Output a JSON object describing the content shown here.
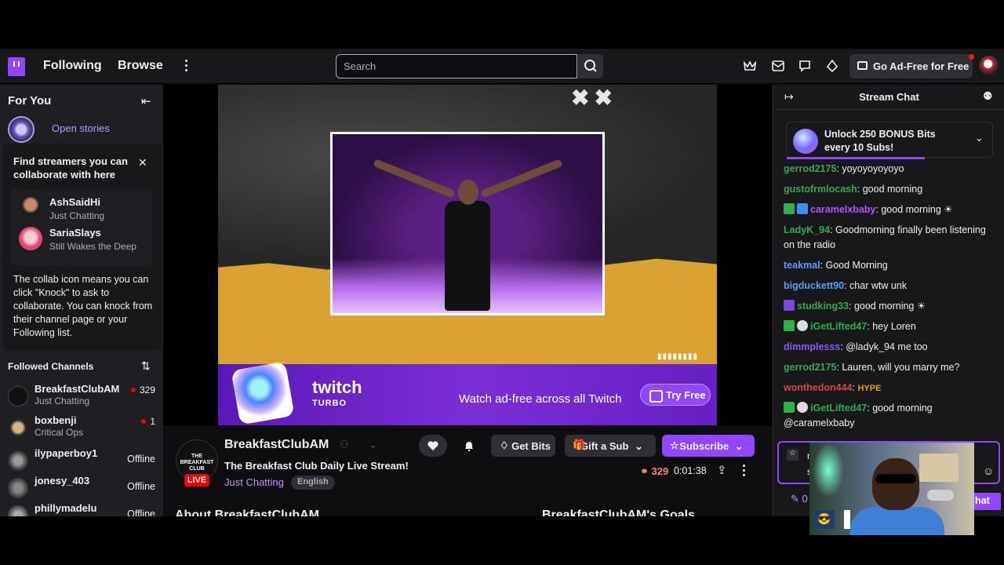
{
  "topnav": {
    "following": "Following",
    "browse": "Browse",
    "search_placeholder": "Search",
    "adfree": "Go Ad-Free for Free"
  },
  "sidebar": {
    "title": "For You",
    "open_stories": "Open stories",
    "collab": {
      "heading": "Find streamers you can collaborate with here",
      "items": [
        {
          "name": "AshSaidHi",
          "game": "Just Chatting"
        },
        {
          "name": "SariaSlays",
          "game": "Still Wakes the Deep"
        }
      ],
      "body": "The collab icon means you can click \"Knock\" to ask to collaborate. You can knock from their channel page or your Following list."
    },
    "followed_title": "Followed Channels",
    "channels": [
      {
        "name": "BreakfastClubAM",
        "game": "Just Chatting",
        "viewers": "329",
        "status": ""
      },
      {
        "name": "boxbenji",
        "game": "Critical Ops",
        "viewers": "1",
        "status": ""
      },
      {
        "name": "ilypaperboy1",
        "game": "",
        "viewers": "",
        "status": "Offline"
      },
      {
        "name": "jonesy_403",
        "game": "",
        "viewers": "",
        "status": "Offline"
      },
      {
        "name": "phillymadelu",
        "game": "",
        "viewers": "",
        "status": "Offline"
      }
    ]
  },
  "player": {
    "logo_text": "THE BREAKFAST CLUB",
    "promo_brand": "twitch",
    "promo_brand_sub": "TURBO",
    "promo_text": "Watch ad-free across all Twitch",
    "try_free": "Try Free"
  },
  "stream": {
    "channel": "BreakfastClubAM",
    "live": "LIVE",
    "title": "The Breakfast Club Daily Live Stream!",
    "category": "Just Chatting",
    "tag": "English",
    "get_bits": "Get Bits",
    "gift_sub": "Gift a Sub",
    "subscribe": "Subscribe",
    "viewers": "329",
    "uptime": "0:01:38",
    "about": "About BreakfastClubAM",
    "goals": "BreakfastClubAM's Goals"
  },
  "chat": {
    "title": "Stream Chat",
    "bits_line1": "Unlock 250 BONUS Bits",
    "bits_line2": "every 10 Subs!",
    "messages": [
      {
        "user": "gerrod2175",
        "text": ": yoyoyoyoyoyo",
        "color": "#36a852"
      },
      {
        "user": "gustofrmlocash",
        "text": ": good morning",
        "color": "#36a852"
      },
      {
        "user": "caramelxbaby",
        "text": ": good morning ☀",
        "color": "#b054ff"
      },
      {
        "user": "LadyK_94",
        "text": ": Goodmorning finally been listening on the radio",
        "color": "#36a852"
      },
      {
        "user": "teakmal",
        "text": ": Good Morning",
        "color": "#5c9cff"
      },
      {
        "user": "bigduckett90",
        "text": ": char wtw unk",
        "color": "#5c9cff"
      },
      {
        "user": "studking33",
        "text": ": good morning ☀",
        "color": "#36a852"
      },
      {
        "user": "iGetLifted47",
        "text": ": hey Loren",
        "color": "#36a852"
      },
      {
        "user": "dimmplesss",
        "text": ": @ladyk_94 me too",
        "color": "#8a5cff"
      },
      {
        "user": "gerrod2175",
        "text": ": Lauren, will you marry me?",
        "color": "#36a852"
      },
      {
        "user": "wonthedon444",
        "text": ": ",
        "hype": "HYPE",
        "color": "#d64747"
      },
      {
        "user": "iGetLifted47",
        "text": ": good morning @caramelxbaby",
        "color": "#36a852"
      }
    ],
    "input_prefix": "m",
    "input_prefix2": "s",
    "footer_chat": "Chat",
    "footer_left": "0"
  },
  "colors": {
    "accent": "#9147ff",
    "live": "#eb0400"
  }
}
